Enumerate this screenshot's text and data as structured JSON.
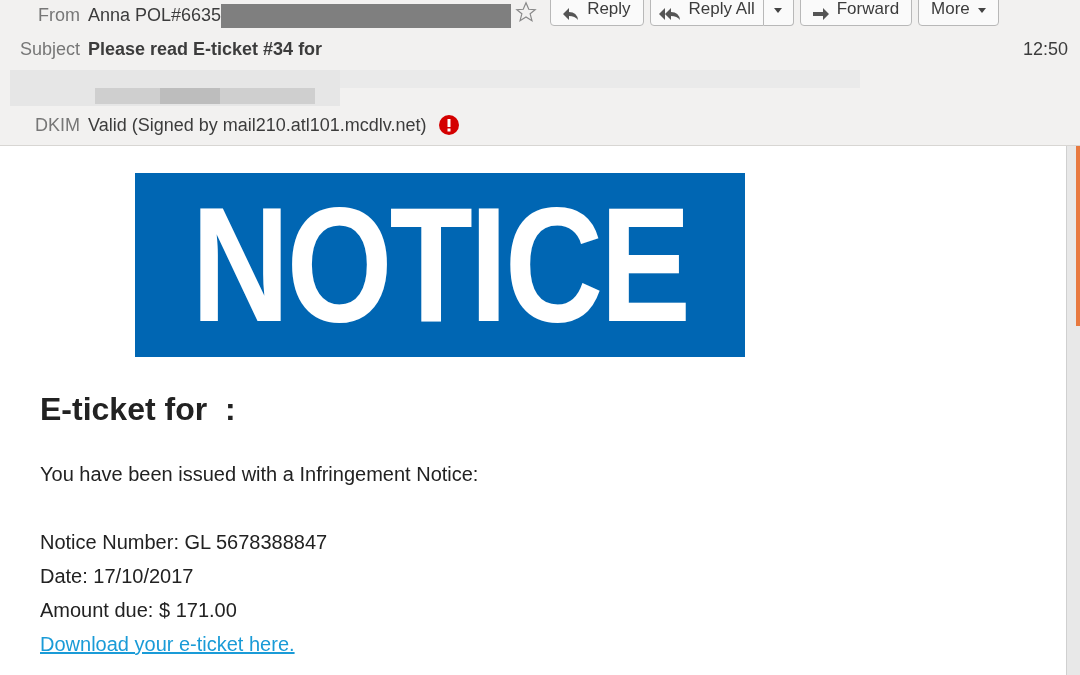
{
  "header": {
    "from_label": "From",
    "from_value": "Anna POL#6635",
    "starred": false,
    "buttons": [
      {
        "label": "Reply",
        "kind": "plain"
      },
      {
        "label": "Reply All",
        "kind": "split"
      },
      {
        "label": "Forward",
        "kind": "plain"
      },
      {
        "label": "More",
        "kind": "menu"
      }
    ],
    "subject_label": "Subject",
    "subject_value": "Please read E-ticket #34 for",
    "time": "12:50",
    "dkim_label": "DKIM",
    "dkim_value": "Valid (Signed by mail210.atl101.mcdlv.net)",
    "dkim_warning": true
  },
  "body": {
    "banner": "NOTICE",
    "heading": "E-ticket for  :",
    "intro": "You have been issued with a Infringement Notice:",
    "details": [
      "Notice Number: GL 5678388847",
      "Date: 17/10/2017",
      "Amount due: $ 171.00"
    ],
    "link": "Download your e-ticket here."
  }
}
